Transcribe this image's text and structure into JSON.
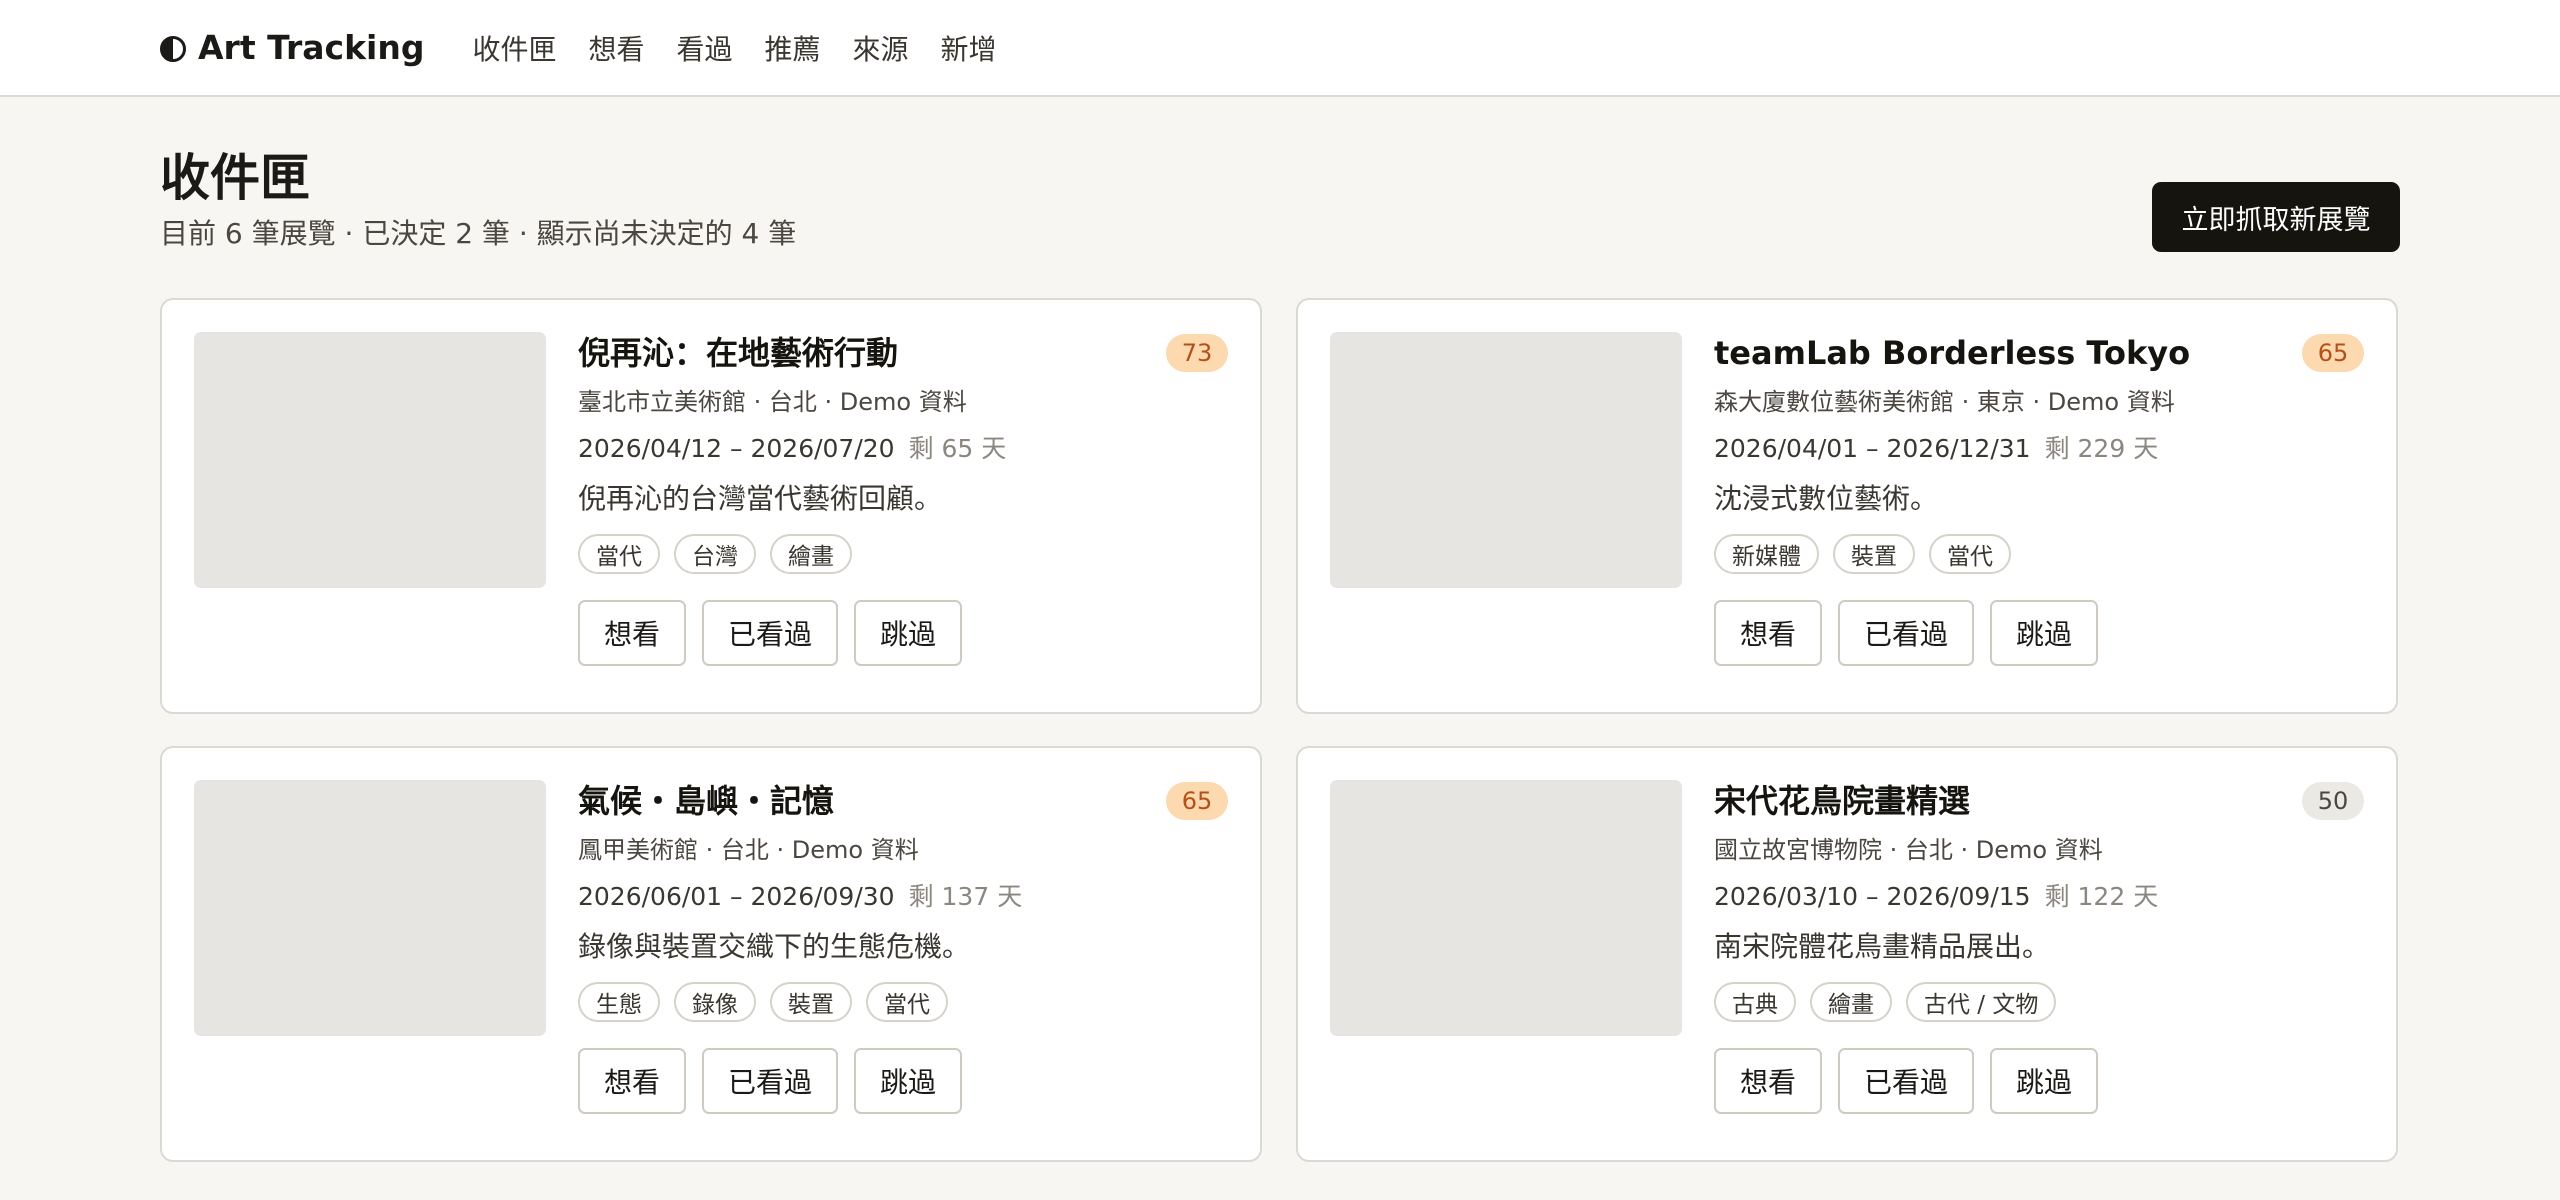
{
  "app": {
    "brand": "Art Tracking",
    "nav": [
      "收件匣",
      "想看",
      "看過",
      "推薦",
      "來源",
      "新增"
    ]
  },
  "header": {
    "title": "收件匣",
    "subtitle": "目前 6 筆展覽 · 已決定 2 筆 · 顯示尚未決定的 4 筆",
    "fetch_label": "立即抓取新展覽"
  },
  "colors": {
    "score_high_bg": "#fdd9b0",
    "score_high_text": "#b5501b",
    "score_mid_bg": "#ebe9e4",
    "score_mid_text": "#4b4740"
  },
  "cards": [
    {
      "title": "倪再沁：在地藝術行動",
      "score": "73",
      "score_level": "high",
      "meta": "臺北市立美術館 · 台北 · Demo 資料",
      "dates": "2026/04/12 – 2026/07/20",
      "remain": "剩 65 天",
      "desc": "倪再沁的台灣當代藝術回顧。",
      "tags": [
        "當代",
        "台灣",
        "繪畫"
      ],
      "actions": [
        "想看",
        "已看過",
        "跳過"
      ]
    },
    {
      "title": "teamLab Borderless Tokyo",
      "score": "65",
      "score_level": "high",
      "meta": "森大廈數位藝術美術館 · 東京 · Demo 資料",
      "dates": "2026/04/01 – 2026/12/31",
      "remain": "剩 229 天",
      "desc": "沈浸式數位藝術。",
      "tags": [
        "新媒體",
        "裝置",
        "當代"
      ],
      "actions": [
        "想看",
        "已看過",
        "跳過"
      ]
    },
    {
      "title": "氣候・島嶼・記憶",
      "score": "65",
      "score_level": "high",
      "meta": "鳳甲美術館 · 台北 · Demo 資料",
      "dates": "2026/06/01 – 2026/09/30",
      "remain": "剩 137 天",
      "desc": "錄像與裝置交織下的生態危機。",
      "tags": [
        "生態",
        "錄像",
        "裝置",
        "當代"
      ],
      "actions": [
        "想看",
        "已看過",
        "跳過"
      ]
    },
    {
      "title": "宋代花鳥院畫精選",
      "score": "50",
      "score_level": "mid",
      "meta": "國立故宮博物院 · 台北 · Demo 資料",
      "dates": "2026/03/10 – 2026/09/15",
      "remain": "剩 122 天",
      "desc": "南宋院體花鳥畫精品展出。",
      "tags": [
        "古典",
        "繪畫",
        "古代 / 文物"
      ],
      "actions": [
        "想看",
        "已看過",
        "跳過"
      ]
    }
  ]
}
